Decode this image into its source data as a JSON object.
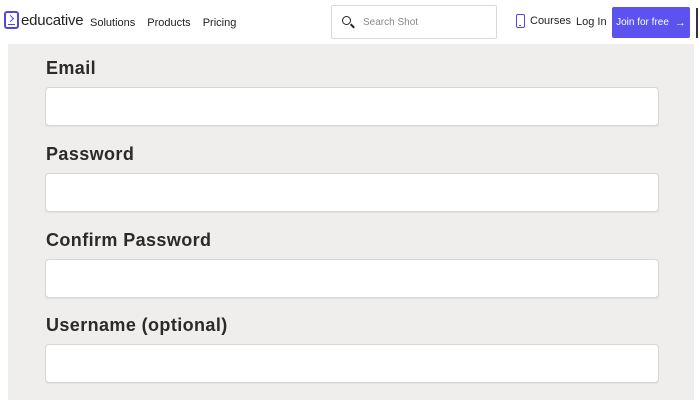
{
  "header": {
    "logo_text": "educative",
    "nav": [
      "Solutions",
      "Products",
      "Pricing"
    ],
    "search_placeholder": "Search Shot",
    "courses_label": "Courses",
    "login_label": "Log In",
    "join_label": "Join for free",
    "join_arrow": "→",
    "brand_color": "#5b52f0"
  },
  "form": {
    "fields": [
      {
        "label": "Email",
        "value": ""
      },
      {
        "label": "Password",
        "value": ""
      },
      {
        "label": "Confirm Password",
        "value": ""
      },
      {
        "label": "Username (optional)",
        "value": ""
      }
    ]
  }
}
